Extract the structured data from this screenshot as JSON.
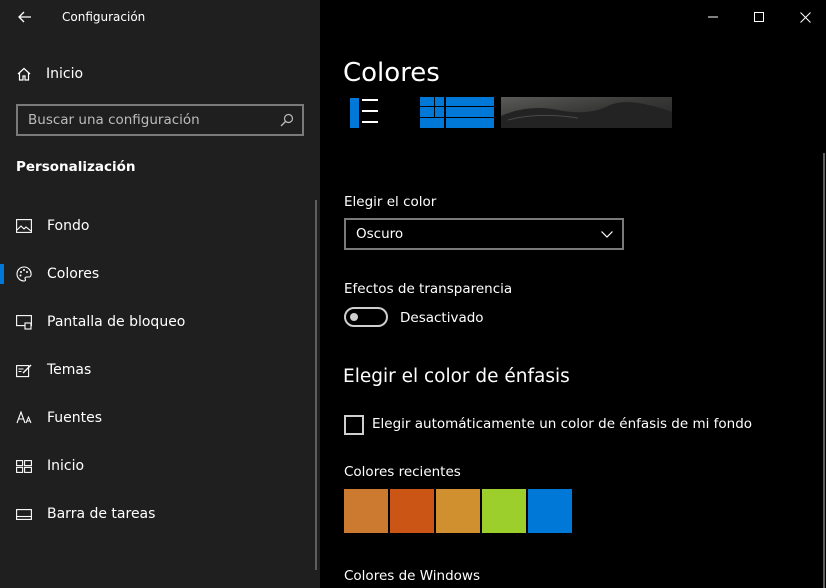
{
  "window": {
    "title": "Configuración"
  },
  "sidebar": {
    "home_label": "Inicio",
    "search_placeholder": "Buscar una configuración",
    "section_title": "Personalización",
    "items": [
      {
        "label": "Fondo",
        "icon": "picture-icon"
      },
      {
        "label": "Colores",
        "icon": "palette-icon",
        "selected": true
      },
      {
        "label": "Pantalla de bloqueo",
        "icon": "lock-screen-icon"
      },
      {
        "label": "Temas",
        "icon": "themes-icon"
      },
      {
        "label": "Fuentes",
        "icon": "fonts-icon"
      },
      {
        "label": "Inicio",
        "icon": "start-icon"
      },
      {
        "label": "Barra de tareas",
        "icon": "taskbar-icon"
      }
    ]
  },
  "main": {
    "title": "Colores",
    "choose_color": {
      "label": "Elegir el color",
      "value": "Oscuro"
    },
    "transparency": {
      "label": "Efectos de transparencia",
      "state": "Desactivado",
      "on": false
    },
    "accent_heading": "Elegir el color de énfasis",
    "auto_accent": {
      "label": "Elegir automáticamente un color de énfasis de mi fondo",
      "checked": false
    },
    "recent_colors": {
      "label": "Colores recientes",
      "swatches": [
        "#cc7a30",
        "#ca5515",
        "#d1902f",
        "#9ccf2c",
        "#0078d7"
      ]
    },
    "windows_colors_label": "Colores de Windows"
  },
  "colors": {
    "accent": "#0078d7",
    "sidebar_bg": "#1f1f1f",
    "main_bg": "#000000"
  }
}
